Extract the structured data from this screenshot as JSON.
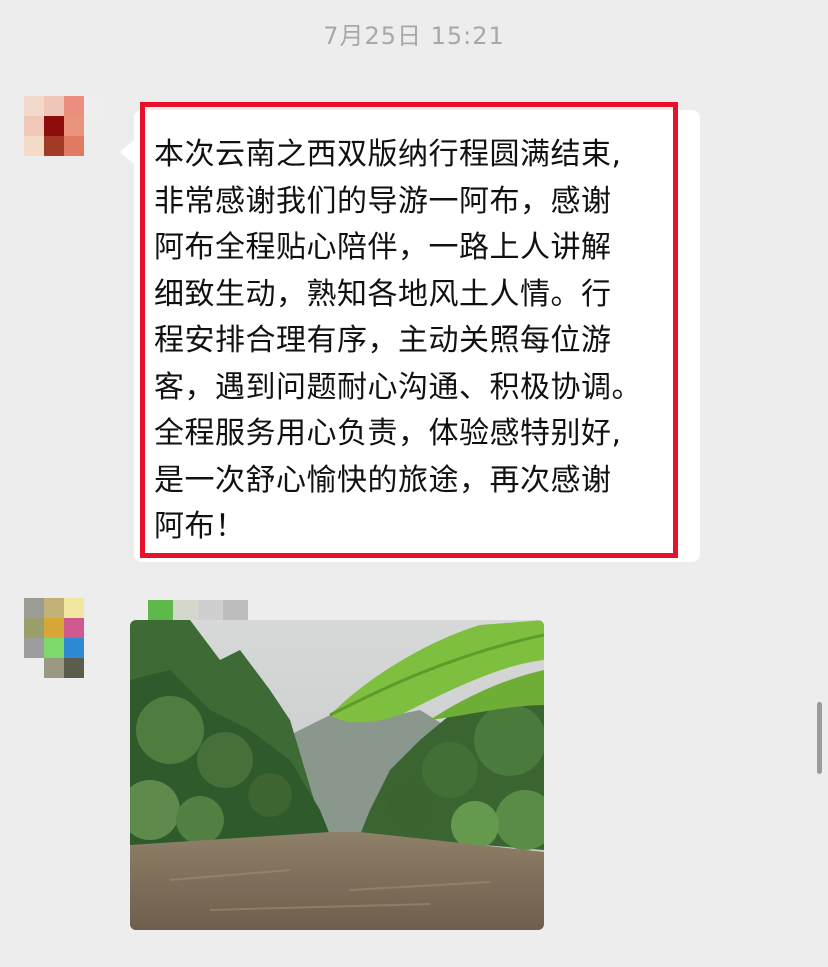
{
  "chat": {
    "timestamp": "7月25日 15:21",
    "messages": [
      {
        "type": "text",
        "text": "本次云南之西双版纳行程圆满结束,\n非常感谢我们的导游一阿布，感谢\n阿布全程贴心陪伴，一路上人讲解\n细致生动，熟知各地风土人情。行\n程安排合理有序，主动关照每位游\n客，遇到问题耐心沟通、积极协调。\n全程服务用心负责，体验感特别好,\n是一次舒心愉快的旅途，再次感谢\n阿布！",
        "highlight_color": "#e8102a"
      },
      {
        "type": "image",
        "image_subject": "river-through-tropical-forest-photo"
      }
    ]
  },
  "colors": {
    "background": "#ededed",
    "bubble": "#ffffff",
    "highlight": "#e8102a",
    "timestamp": "#a8a8a8"
  }
}
